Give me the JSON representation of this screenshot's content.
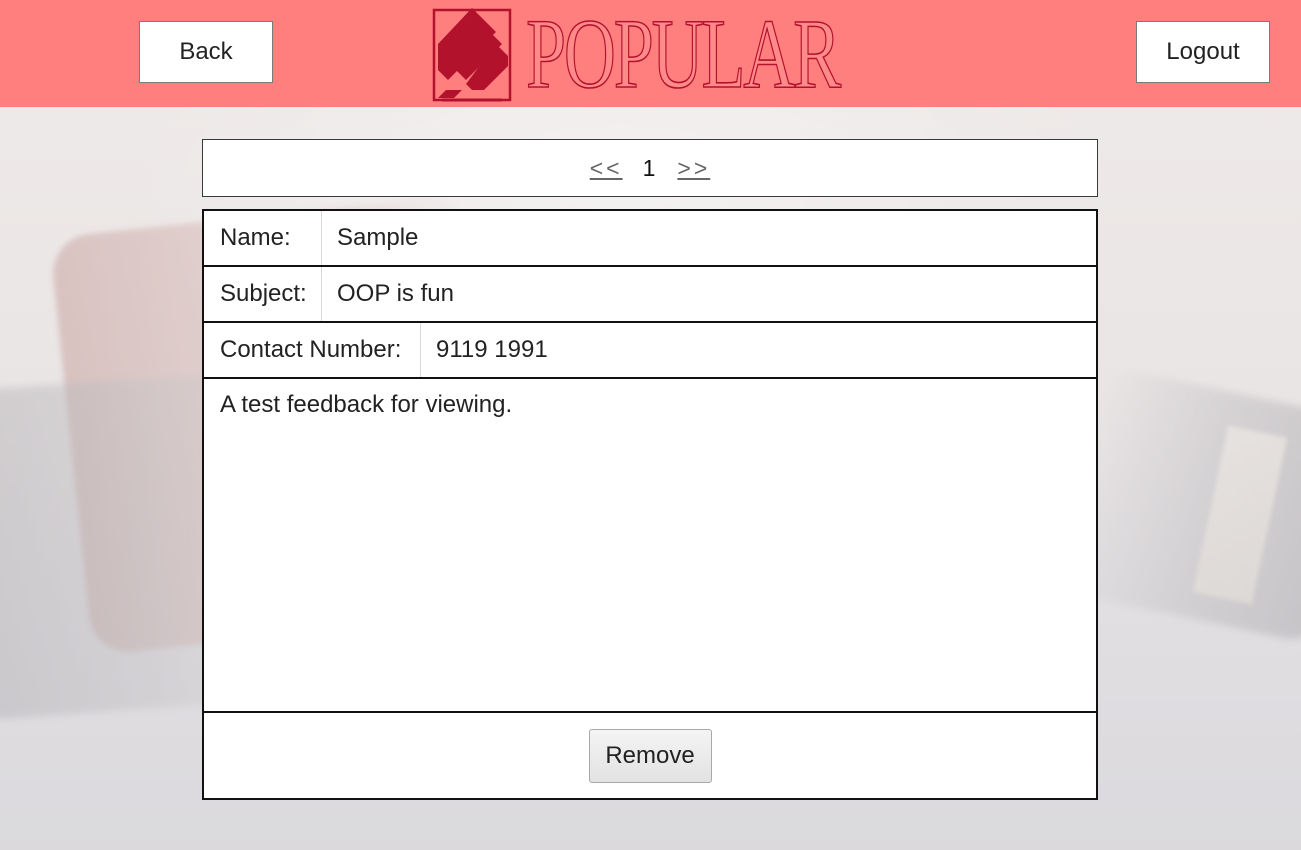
{
  "header": {
    "back_label": "Back",
    "logout_label": "Logout",
    "logo_text": "POPULAR",
    "background_color": "#ff7f7f",
    "logo_color": "#b3122d"
  },
  "pager": {
    "prev_label": "<<",
    "current_page": "1",
    "next_label": ">>"
  },
  "feedback": {
    "name_label": "Name:",
    "name_value": "Sample",
    "subject_label": "Subject:",
    "subject_value": "OOP is fun",
    "contact_label": "Contact Number:",
    "contact_value": "9119 1991",
    "message": "A test feedback for viewing.",
    "remove_label": "Remove"
  }
}
